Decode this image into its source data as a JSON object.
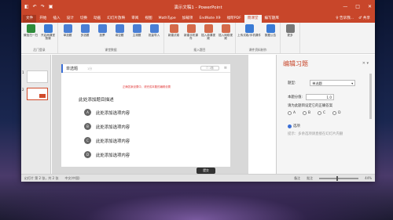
{
  "window": {
    "title": "演示文稿1 - PowerPoint",
    "user": "共享"
  },
  "qat": [
    "◧",
    "↶",
    "↷",
    "▣"
  ],
  "win_controls": [
    "—",
    "□",
    "✕"
  ],
  "tabs": [
    "文件",
    "开始",
    "插入",
    "设计",
    "切换",
    "动画",
    "幻灯片放映",
    "审阅",
    "视图",
    "MathType",
    "加载项",
    "EndNote X9",
    "福昕PDF",
    "雨课堂",
    "编写题库"
  ],
  "active_tab": "雨课堂",
  "tabs_right": [
    "♀ 告诉我...",
    "♂ 共享"
  ],
  "ribbon": {
    "groups": [
      {
        "label": "后门登录",
        "buttons": [
          {
            "label": "微信扫一扫",
            "color": "#2e8b3a"
          },
          {
            "label": "开启雨课堂授课",
            "color": "#3a7bd5"
          }
        ]
      },
      {
        "label": "课堂数据",
        "buttons": [
          {
            "label": "单选题",
            "color": "#4a7fd4"
          },
          {
            "label": "多选题",
            "color": "#4a7fd4"
          },
          {
            "label": "投票",
            "color": "#4a7fd4"
          },
          {
            "label": "填空题",
            "color": "#4a7fd4"
          },
          {
            "label": "主观题",
            "color": "#4a7fd4"
          },
          {
            "label": "批量导入",
            "color": "#4a7fd4"
          }
        ]
      },
      {
        "label": "插入题目",
        "buttons": [
          {
            "label": "新建试卷",
            "color": "#d46a4a"
          },
          {
            "label": "新建手机课件",
            "color": "#d46a4a"
          },
          {
            "label": "插入慕课视频",
            "color": "#d46a4a"
          },
          {
            "label": "插入网络视频",
            "color": "#d46a4a"
          }
        ]
      },
      {
        "label": "课件资料制作",
        "buttons": [
          {
            "label": "上传试卷/手机课件",
            "color": "#3a7bd5"
          },
          {
            "label": "数据公告",
            "color": "#3a7bd5"
          }
        ]
      },
      {
        "label": "",
        "buttons": [
          {
            "label": "更多",
            "color": "#777777"
          }
        ]
      }
    ]
  },
  "thumbnails": [
    "1",
    "2"
  ],
  "question": {
    "type": "单选题",
    "score_hint": "1分",
    "count_box": "☐ 1题",
    "menu": "≡",
    "warning": "正确答案设置中，请完成本题的编辑设置",
    "stem": "此处添加题目描述",
    "options": [
      {
        "letter": "A",
        "text": "此处添加选项内容"
      },
      {
        "letter": "B",
        "text": "此处添加选项内容"
      },
      {
        "letter": "C",
        "text": "此处添加选项内容"
      },
      {
        "letter": "D",
        "text": "此处添加选项内容"
      }
    ],
    "submit": "提交"
  },
  "edit_panel": {
    "title": "编辑习题",
    "close": "✕ ▾",
    "type_label": "题型:",
    "type_value": "单选题",
    "score_label": "本题分值:",
    "score_value": "1.0",
    "answer_label": "请为此题目设定它的正确答案",
    "answer_options": [
      "A",
      "B",
      "C",
      "D"
    ],
    "option_label": "选项",
    "option_hint": "提示：多余选项请直接在幻灯片内删"
  },
  "status": {
    "slide": "幻灯片 第 2 张，共 2 张",
    "lang": "中文(中国)",
    "notes": "备注",
    "comments": "批注",
    "zoom": "44%"
  },
  "colors": {
    "accent": "#c8462a",
    "blue": "#3b6fd6"
  }
}
